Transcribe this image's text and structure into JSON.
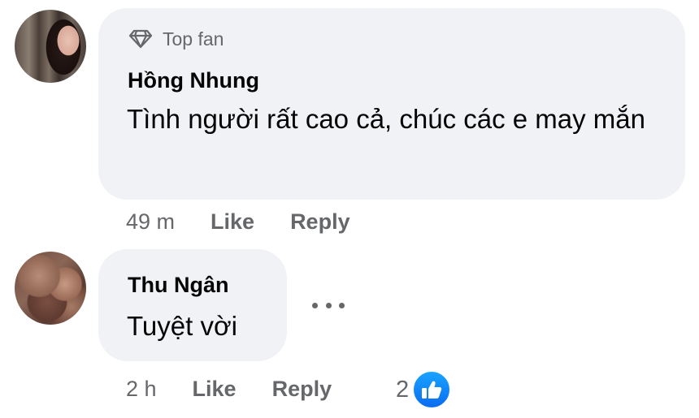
{
  "comments": [
    {
      "badge_label": "Top fan",
      "badge_icon": "diamond-icon",
      "author": "Hồng Nhung",
      "text": "Tình người rất cao cả, chúc các e may mắn",
      "time": "49 m",
      "like_label": "Like",
      "reply_label": "Reply"
    },
    {
      "author": "Thu Ngân",
      "text": "Tuyệt vời",
      "time": "2 h",
      "like_label": "Like",
      "reply_label": "Reply",
      "more_icon": "more-options-icon",
      "reaction_count": "2",
      "reaction_icon": "like-reaction-icon",
      "reaction_color": "#0a6cf1"
    }
  ]
}
